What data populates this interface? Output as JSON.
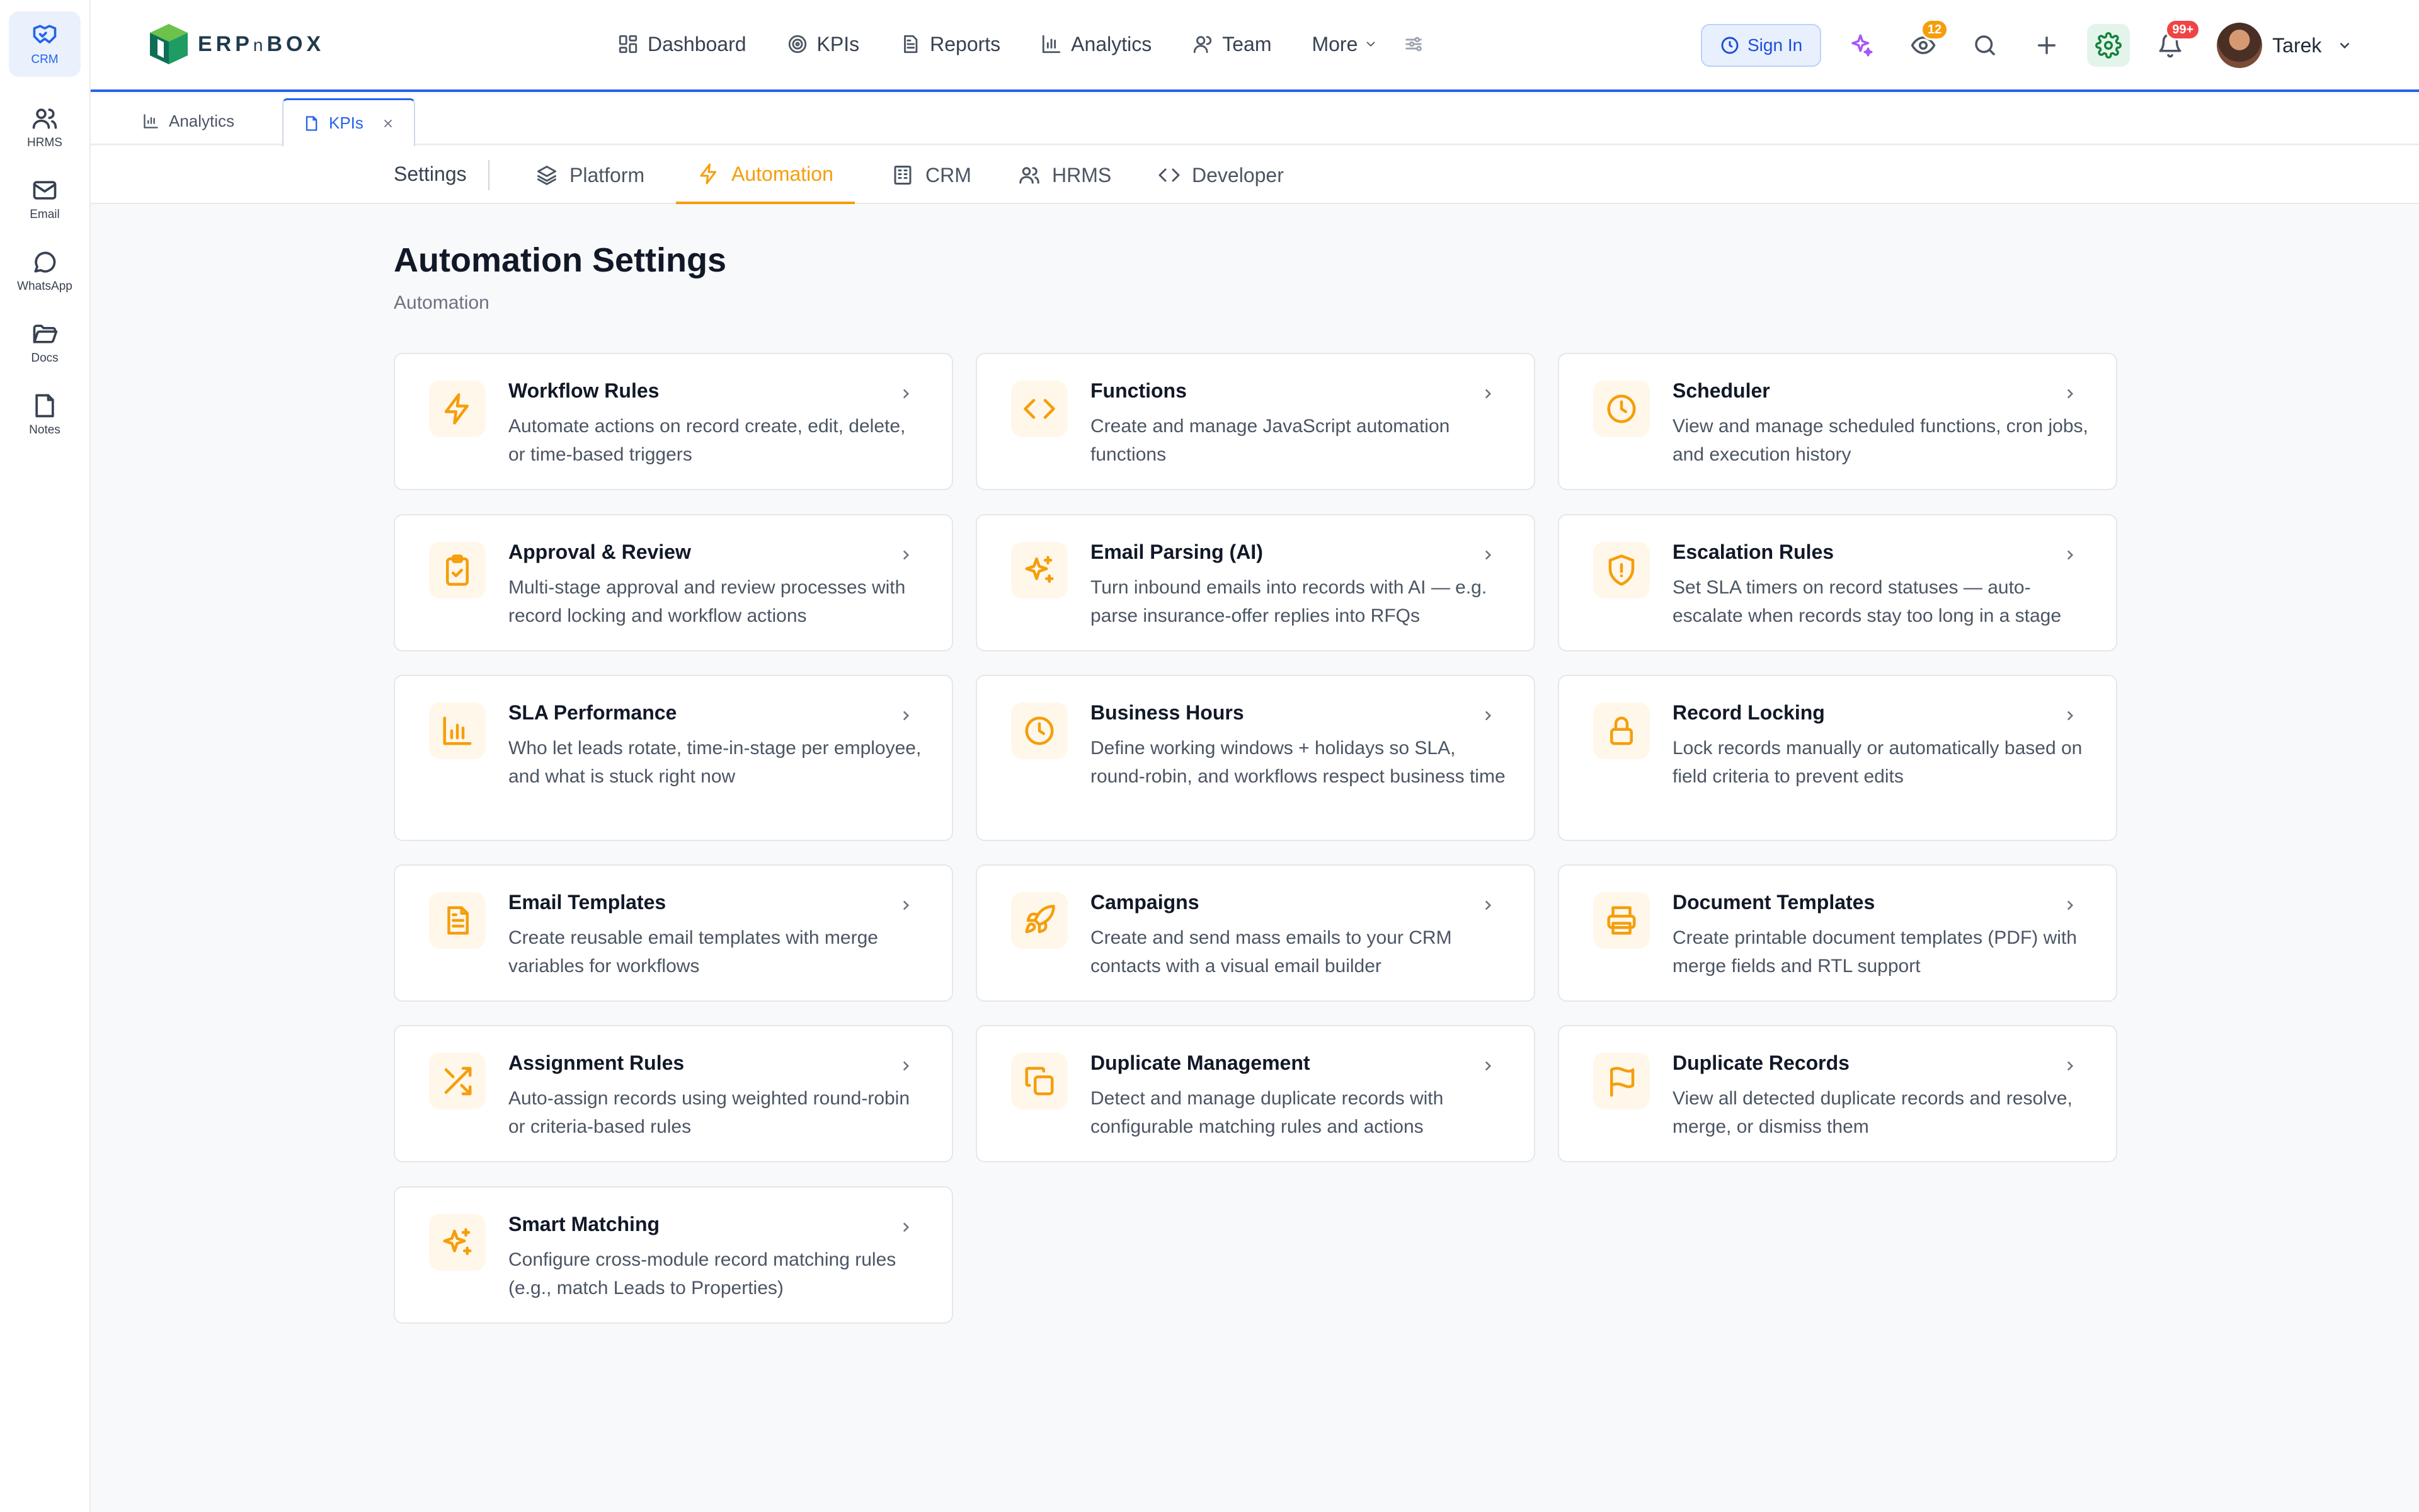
{
  "rail": {
    "items": [
      {
        "label": "CRM",
        "icon": "handshake-icon",
        "active": true
      },
      {
        "label": "HRMS",
        "icon": "users-icon"
      },
      {
        "label": "Email",
        "icon": "mail-icon"
      },
      {
        "label": "WhatsApp",
        "icon": "chat-bubble-icon"
      },
      {
        "label": "Docs",
        "icon": "folder-icon"
      },
      {
        "label": "Notes",
        "icon": "note-icon"
      }
    ]
  },
  "header": {
    "brand_main": "ERP",
    "brand_small": "n",
    "brand_end": "BOX",
    "nav": [
      {
        "label": "Dashboard",
        "icon": "dashboard-icon"
      },
      {
        "label": "KPIs",
        "icon": "target-icon"
      },
      {
        "label": "Reports",
        "icon": "document-icon"
      },
      {
        "label": "Analytics",
        "icon": "bar-chart-icon"
      },
      {
        "label": "Team",
        "icon": "user-icon"
      },
      {
        "label": "More",
        "icon": "chevron-down-icon"
      }
    ],
    "sign_in_label": "Sign In",
    "watch_badge": "12",
    "notifications_badge": "99+",
    "user_name": "Tarek"
  },
  "tabs": [
    {
      "label": "Analytics",
      "icon": "bar-chart-icon"
    },
    {
      "label": "KPIs",
      "icon": "file-icon",
      "active": true
    }
  ],
  "subnav": {
    "settings_label": "Settings",
    "items": [
      {
        "label": "Platform",
        "icon": "layers-icon"
      },
      {
        "label": "Automation",
        "icon": "bolt-icon",
        "active": true
      },
      {
        "label": "CRM",
        "icon": "building-icon"
      },
      {
        "label": "HRMS",
        "icon": "users-icon"
      },
      {
        "label": "Developer",
        "icon": "code-icon"
      }
    ]
  },
  "page": {
    "title": "Automation Settings",
    "subtitle": "Automation"
  },
  "cards": [
    {
      "title": "Workflow Rules",
      "desc": "Automate actions on record create, edit, delete, or time-based triggers",
      "icon": "bolt-icon"
    },
    {
      "title": "Functions",
      "desc": "Create and manage JavaScript automation functions",
      "icon": "code-icon"
    },
    {
      "title": "Scheduler",
      "desc": "View and manage scheduled functions, cron jobs, and execution history",
      "icon": "clock-icon"
    },
    {
      "title": "Approval & Review",
      "desc": "Multi-stage approval and review processes with record locking and workflow actions",
      "icon": "clipboard-check-icon"
    },
    {
      "title": "Email Parsing (AI)",
      "desc": "Turn inbound emails into records with AI — e.g. parse insurance-offer replies into RFQs",
      "icon": "sparkles-icon"
    },
    {
      "title": "Escalation Rules",
      "desc": "Set SLA timers on record statuses — auto-escalate when records stay too long in a stage",
      "icon": "shield-alert-icon"
    },
    {
      "title": "SLA Performance",
      "desc": "Who let leads rotate, time-in-stage per employee, and what is stuck right now",
      "icon": "bar-chart-icon"
    },
    {
      "title": "Business Hours",
      "desc": "Define working windows + holidays so SLA, round-robin, and workflows respect business time",
      "icon": "clock-icon"
    },
    {
      "title": "Record Locking",
      "desc": "Lock records manually or automatically based on field criteria to prevent edits",
      "icon": "lock-icon"
    },
    {
      "title": "Email Templates",
      "desc": "Create reusable email templates with merge variables for workflows",
      "icon": "document-icon"
    },
    {
      "title": "Campaigns",
      "desc": "Create and send mass emails to your CRM contacts with a visual email builder",
      "icon": "rocket-icon"
    },
    {
      "title": "Document Templates",
      "desc": "Create printable document templates (PDF) with merge fields and RTL support",
      "icon": "printer-icon"
    },
    {
      "title": "Assignment Rules",
      "desc": "Auto-assign records using weighted round-robin or criteria-based rules",
      "icon": "shuffle-icon"
    },
    {
      "title": "Duplicate Management",
      "desc": "Detect and manage duplicate records with configurable matching rules and actions",
      "icon": "copy-icon"
    },
    {
      "title": "Duplicate Records",
      "desc": "View all detected duplicate records and resolve, merge, or dismiss them",
      "icon": "flag-icon"
    },
    {
      "title": "Smart Matching",
      "desc": "Configure cross-module record matching rules (e.g., match Leads to Properties)",
      "icon": "sparkles-icon"
    }
  ]
}
